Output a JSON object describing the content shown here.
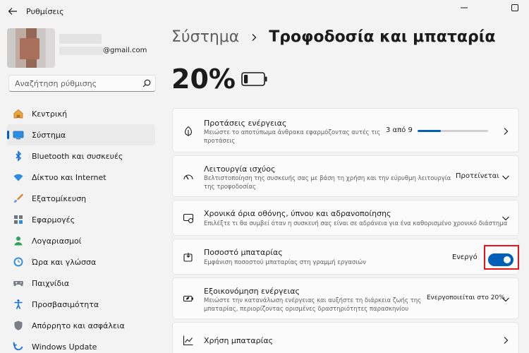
{
  "window": {
    "title": "Ρυθμίσεις"
  },
  "profile": {
    "email_suffix": "@gmail.com"
  },
  "search": {
    "placeholder": "Αναζήτηση ρύθμισης"
  },
  "sidebar": {
    "items": [
      {
        "label": "Κεντρική",
        "icon": "home-icon"
      },
      {
        "label": "Σύστημα",
        "icon": "system-icon",
        "active": true
      },
      {
        "label": "Bluetooth και συσκευές",
        "icon": "bluetooth-icon"
      },
      {
        "label": "Δίκτυο και Internet",
        "icon": "wifi-icon"
      },
      {
        "label": "Εξατομίκευση",
        "icon": "brush-icon"
      },
      {
        "label": "Εφαρμογές",
        "icon": "apps-icon"
      },
      {
        "label": "Λογαριασμοί",
        "icon": "accounts-icon"
      },
      {
        "label": "Ώρα και γλώσσα",
        "icon": "time-language-icon"
      },
      {
        "label": "Παιχνίδια",
        "icon": "gamepad-icon"
      },
      {
        "label": "Προσβασιμότητα",
        "icon": "accessibility-icon"
      },
      {
        "label": "Απόρρητο και ασφάλεια",
        "icon": "shield-icon"
      },
      {
        "label": "Windows Update",
        "icon": "update-icon"
      }
    ]
  },
  "header": {
    "breadcrumb_root": "Σύστημα",
    "breadcrumb_current": "Τροφοδοσία και μπαταρία"
  },
  "battery": {
    "percent": "20%",
    "level": 0.2
  },
  "cards": {
    "energy": {
      "title": "Προτάσεις ενέργειας",
      "desc_line1": "Μειώστε το αποτύπωμα άνθρακα εφαρμόζοντας αυτές τις",
      "desc_line2": "προτάσεις",
      "progress_text": "3 από 9",
      "progress": 0.33
    },
    "power_mode": {
      "title": "Λειτουργία ισχύος",
      "desc_line1": "Βελτιστοποίηση της συσκευής σας με βάση τη χρήση και την εύρυθμη λειτουργία",
      "desc_line2": "της τροφοδοσίας",
      "value": "Προτείνεται"
    },
    "screen_sleep": {
      "title": "Χρονικά όρια οθόνης, ύπνου και αδρανοποίησης",
      "desc": "Επιλέξτε τι θα συμβεί όταν η συσκευή σας είναι σε αδράνεια για ένα καθορισμένο χρονικό διάστημα"
    },
    "battery_percent": {
      "title": "Ποσοστό μπαταρίας",
      "desc": "Εμφάνιση ποσοστού μπαταρίας στη γραμμή εργασιών",
      "state": "Ενεργό",
      "on": true
    },
    "energy_saver": {
      "title": "Εξοικονόμηση ενέργειας",
      "desc_line1": "Μειώστε την κατανάλωση ενέργειας και αυξήστε τη διάρκεια ζωής της",
      "desc_line2": "μπαταρίας, περιορίζοντας ορισμένες δραστηριότητες παρασκηνίου",
      "value": "Ενεργοποιείται στο 20%"
    },
    "battery_usage": {
      "title": "Χρήση μπαταρίας"
    }
  },
  "colors": {
    "accent": "#005fb8",
    "highlight": "#e8141c"
  }
}
